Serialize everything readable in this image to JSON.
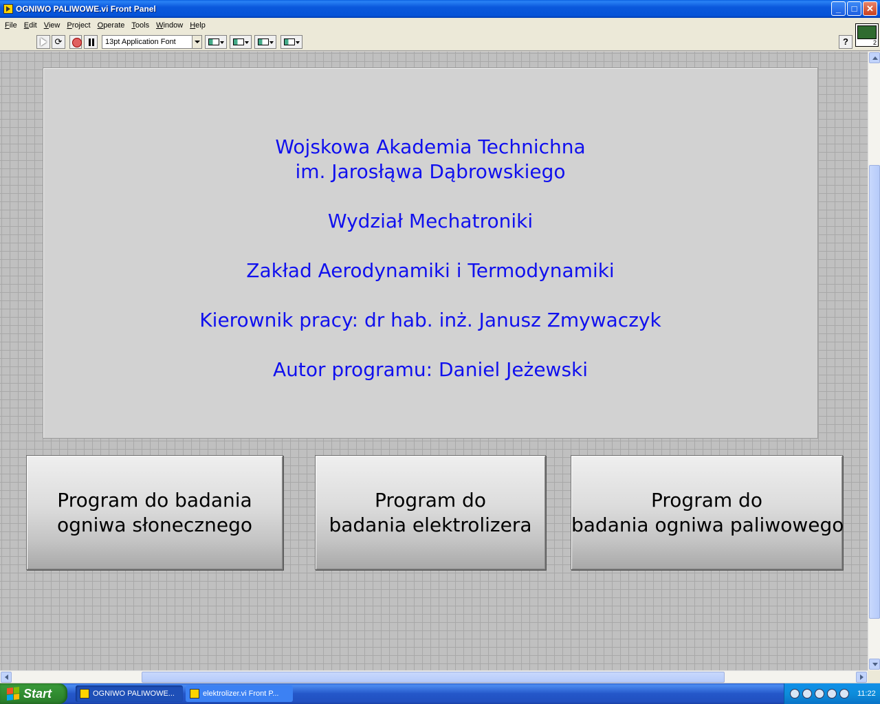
{
  "window": {
    "title": "OGNIWO PALIWOWE.vi Front Panel",
    "controls": [
      "minimize-icon",
      "maximize-icon",
      "close-icon"
    ]
  },
  "menubar": {
    "items": [
      "File",
      "Edit",
      "View",
      "Project",
      "Operate",
      "Tools",
      "Window",
      "Help"
    ]
  },
  "toolbar": {
    "font_select": "13pt Application Font",
    "vi_icon_number": "2"
  },
  "info": {
    "lines": [
      "Wojskowa Akademia Technichna",
      "im. Jarosłąwa Dąbrowskiego",
      "Wydział Mechatroniki",
      "Zakład Aerodynamiki i Termodynamiki",
      "Kierownik pracy: dr hab. inż. Janusz Zmywaczyk",
      "Autor programu: Daniel Jeżewski"
    ],
    "text_color": "#1010ee"
  },
  "buttons": {
    "solar": [
      "Program do badania",
      "ogniwa słonecznego"
    ],
    "electrolyzer": [
      "Program do",
      "badania elektrolizera"
    ],
    "fuel": [
      "Program do",
      "badania ogniwa paliwowego"
    ]
  },
  "taskbar": {
    "start_label": "Start",
    "tasks": [
      "OGNIWO PALIWOWE...",
      "elektrolizer.vi Front P..."
    ],
    "clock": "11:22"
  }
}
